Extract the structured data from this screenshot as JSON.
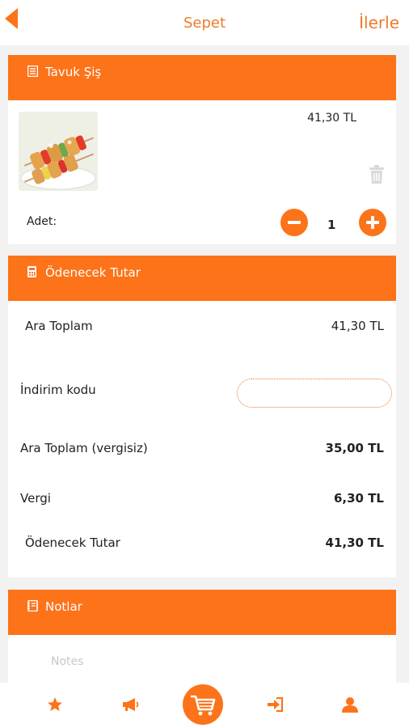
{
  "header": {
    "title": "Sepet",
    "next_label": "İlerle"
  },
  "product": {
    "section_title": "Tavuk Şiş",
    "price": "41,30 TL",
    "qty_label": "Adet:",
    "quantity": "1"
  },
  "totals": {
    "section_title": "Ödenecek Tutar",
    "subtotal_label": "Ara Toplam",
    "subtotal_value": "41,30 TL",
    "discount_label": "İndirim kodu",
    "discount_value": "",
    "net_label": "Ara Toplam (vergisiz)",
    "net_value": "35,00 TL",
    "tax_label": "Vergi",
    "tax_value": "6,30 TL",
    "total_label": "Ödenecek Tutar",
    "total_value": "41,30 TL"
  },
  "notes": {
    "section_title": "Notlar",
    "placeholder": "Notes"
  },
  "colors": {
    "accent": "#fd7319",
    "link": "#f07a2a"
  },
  "nav": {
    "items": [
      "star-icon",
      "megaphone-icon",
      "cart-icon",
      "login-icon",
      "user-icon"
    ],
    "active": "cart-icon"
  }
}
